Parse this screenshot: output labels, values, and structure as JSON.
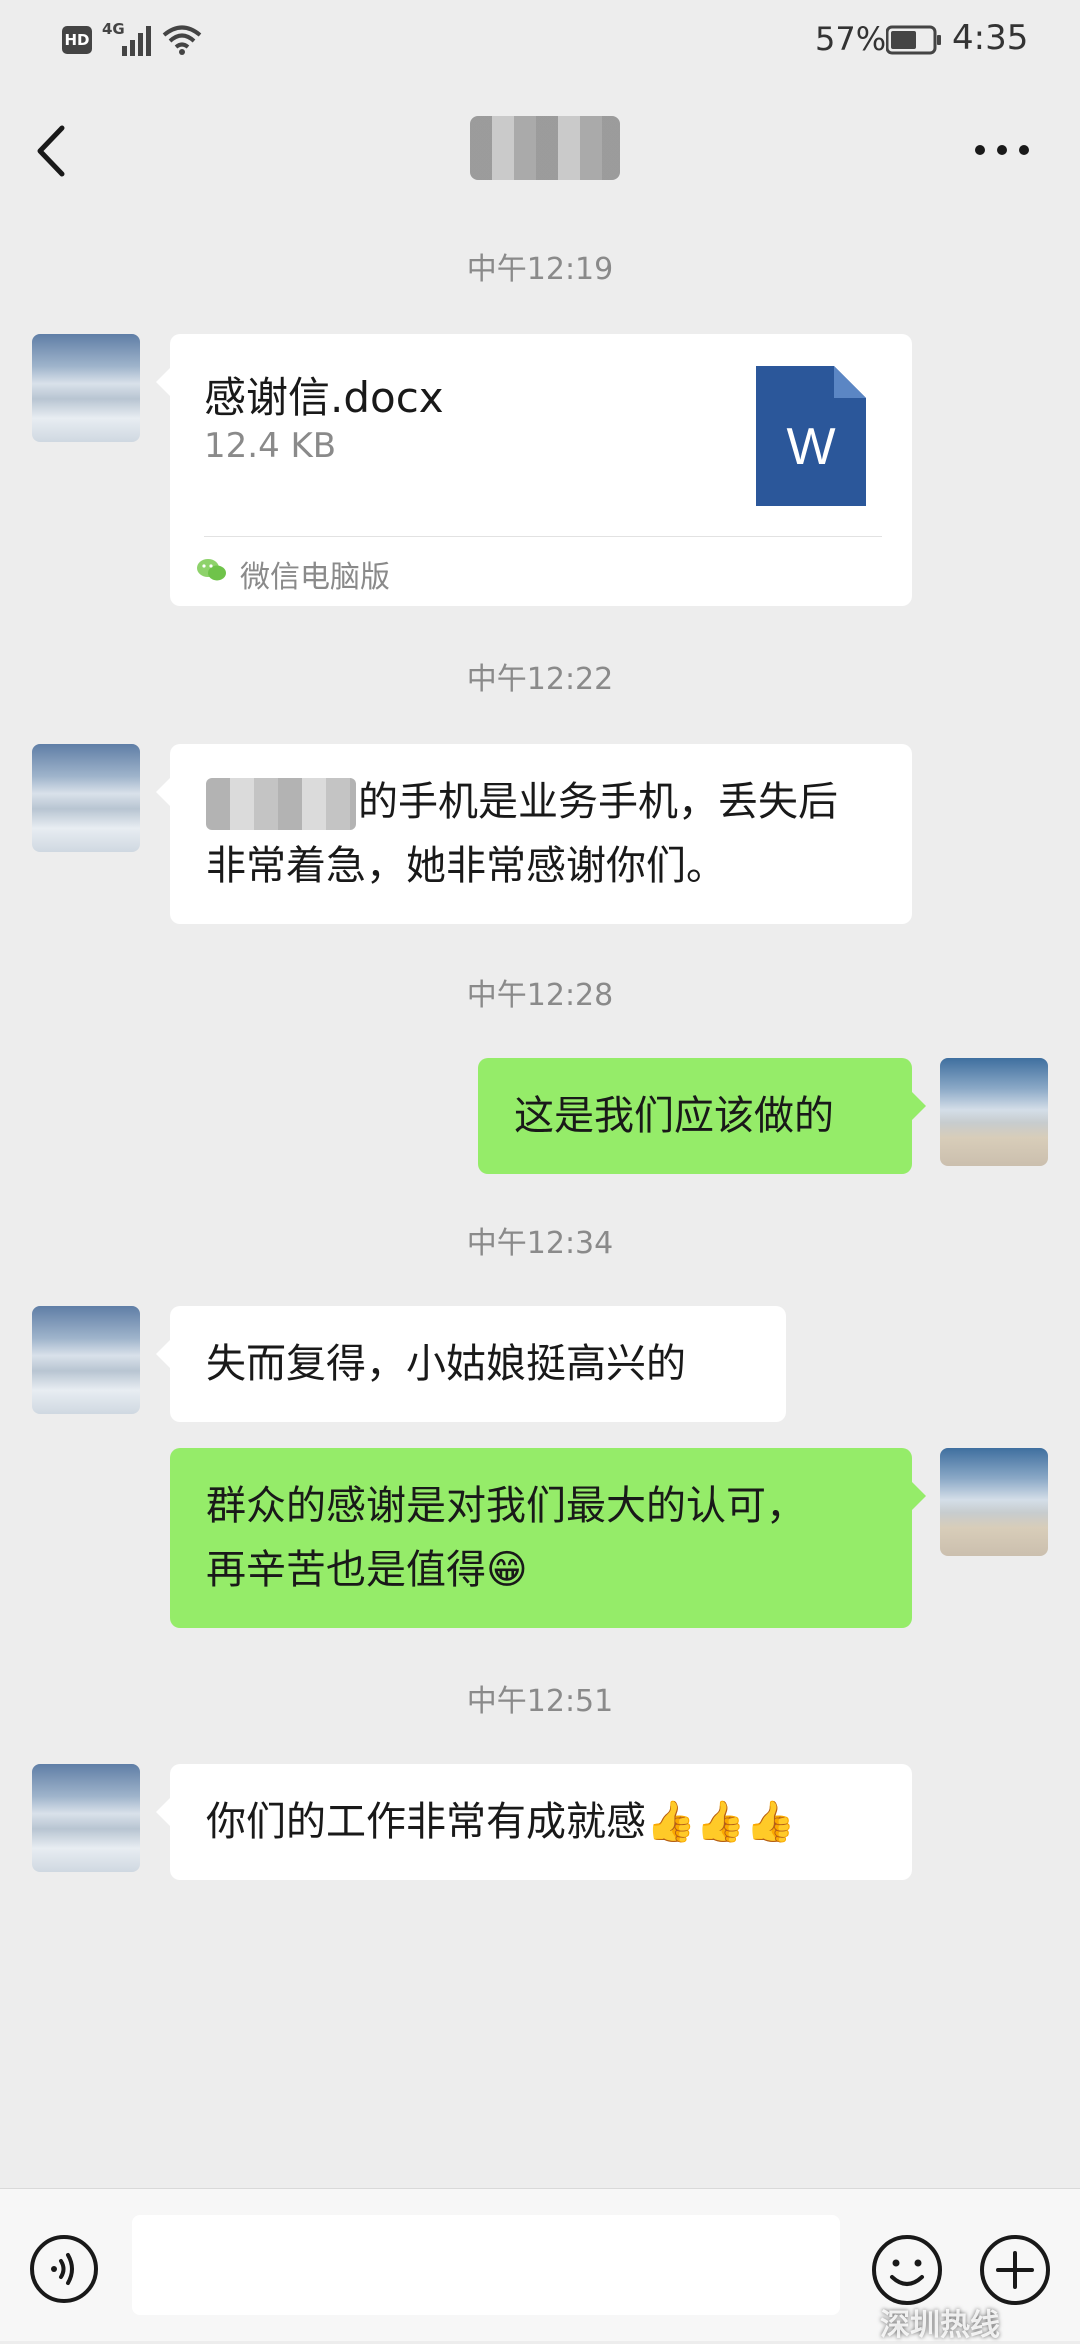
{
  "status_bar": {
    "hd": "HD",
    "network": "4G",
    "battery": "57%",
    "time": "4:35"
  },
  "nav": {
    "title": "",
    "back_icon": "back-chevron-icon",
    "more_icon": "more-dots-icon"
  },
  "messages": [
    {
      "time": "中午12:19"
    },
    {
      "file_name": "感谢信.docx",
      "file_size": "12.4 KB",
      "source": "微信电脑版"
    },
    {
      "time": "中午12:22"
    },
    {
      "text_line1": "的手机是业务手机，丢失后",
      "text_line2": "非常着急，她非常感谢你们。"
    },
    {
      "time": "中午12:28"
    },
    {
      "text": "这是我们应该做的"
    },
    {
      "time": "中午12:34"
    },
    {
      "text": "失而复得，小姑娘挺高兴的"
    },
    {
      "text_line1": "群众的感谢是对我们最大的认可，",
      "text_line2": "再辛苦也是值得",
      "emoji": "😁"
    },
    {
      "time": "中午12:51"
    },
    {
      "text": "你们的工作非常有成就感",
      "emoji": "👍👍👍"
    }
  ],
  "input": {
    "placeholder": ""
  },
  "watermark": "深圳热线",
  "colors": {
    "background": "#ededed",
    "outgoing_bubble": "#95ec69",
    "incoming_bubble": "#ffffff",
    "timestamp": "#8a8a8a",
    "word_icon": "#2b579a"
  }
}
